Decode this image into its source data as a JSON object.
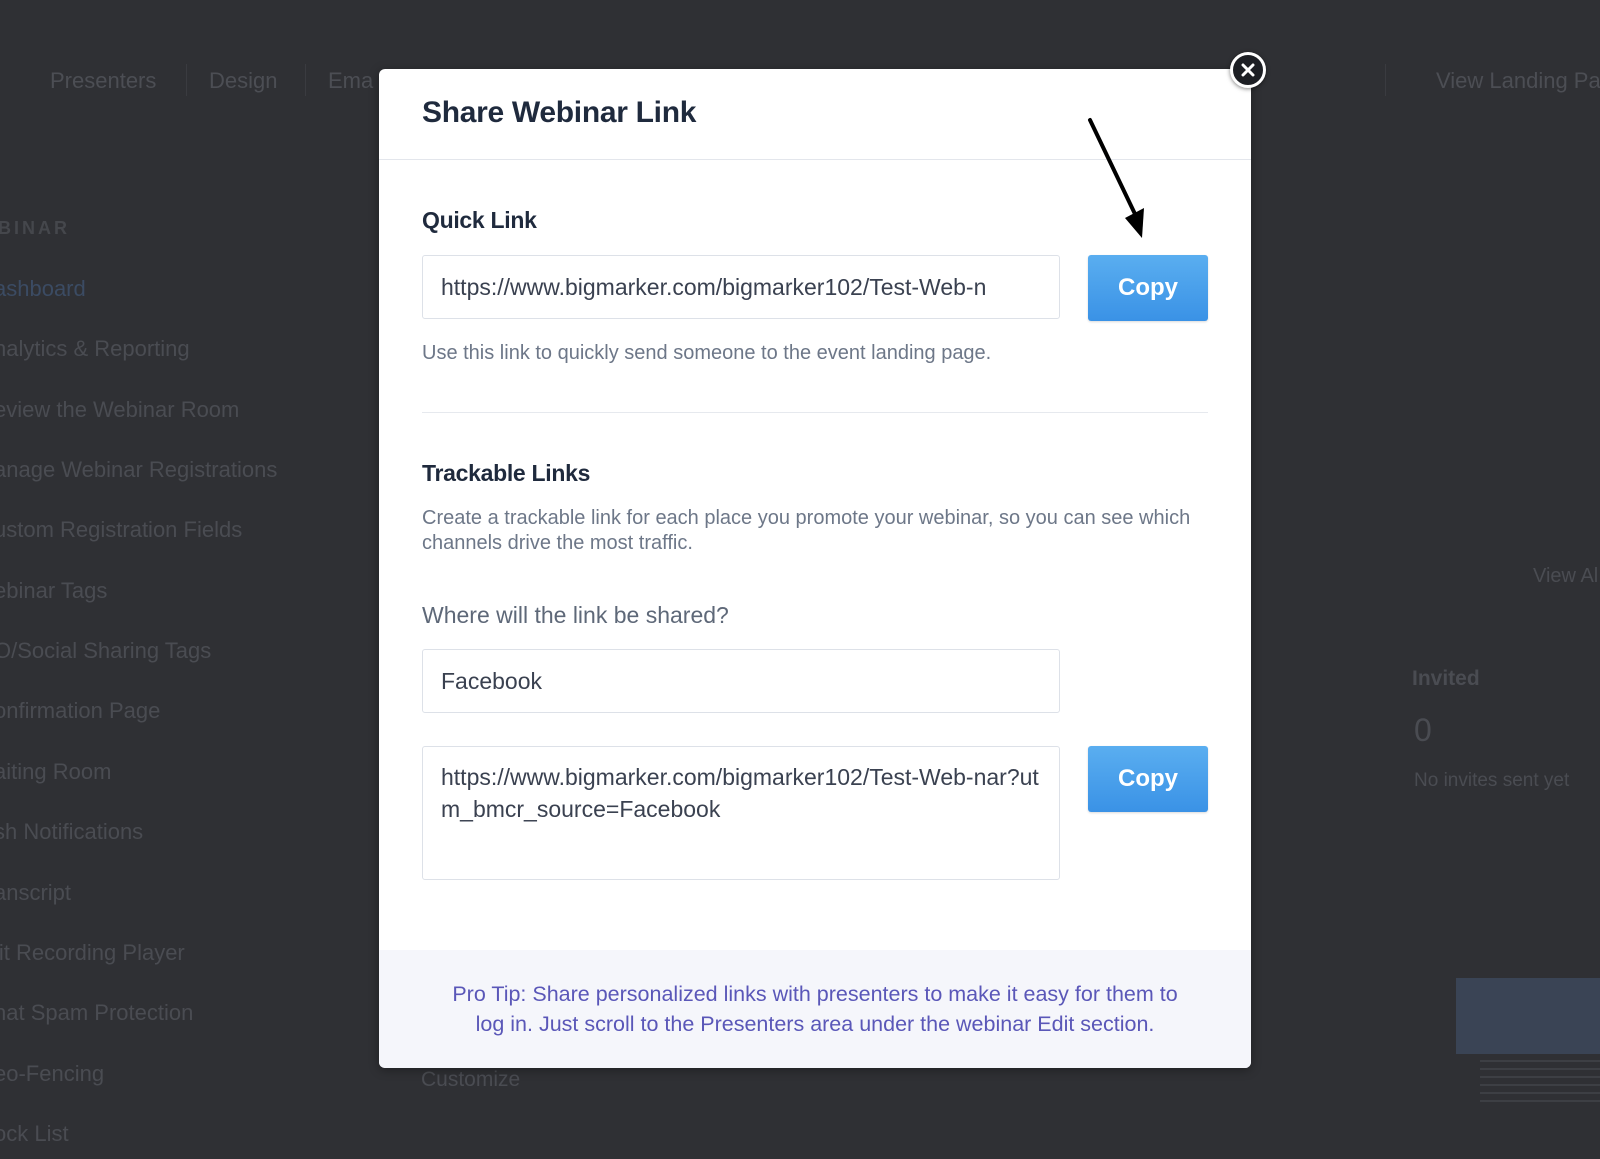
{
  "background": {
    "top_nav": [
      "Presenters",
      "Design",
      "Ema",
      "View Landing Pa"
    ],
    "sidebar_section": "BINAR",
    "sidebar_items": [
      "ashboard",
      "nalytics & Reporting",
      "eview the Webinar Room",
      "anage Webinar Registrations",
      "ustom Registration Fields",
      "ebinar Tags",
      "O/Social Sharing Tags",
      "onfirmation Page",
      "aiting Room",
      "sh Notifications",
      "anscript",
      "lit Recording Player",
      "hat Spam Protection",
      "eo-Fencing",
      "ock List"
    ],
    "view_all": "View Al",
    "invited_label": "Invited",
    "invited_count": "0",
    "invited_note": "No invites sent yet",
    "customize_link": "Customize"
  },
  "modal": {
    "title": "Share Webinar Link",
    "quick_link": {
      "label": "Quick Link",
      "url": "https://www.bigmarker.com/bigmarker102/Test-Web-n",
      "copy_label": "Copy",
      "helper": "Use this link to quickly send someone to the event landing page."
    },
    "trackable": {
      "label": "Trackable Links",
      "description": "Create a trackable link for each place you promote your webinar, so you can see which channels drive the most traffic.",
      "question": "Where will the link be shared?",
      "channel_value": "Facebook",
      "generated_url": "https://www.bigmarker.com/bigmarker102/Test-Web-nar?utm_bmcr_source=Facebook",
      "copy_label": "Copy"
    },
    "pro_tip": "Pro Tip: Share personalized links with presenters to make it easy for them to log in. Just scroll to the Presenters area under the webinar Edit section."
  },
  "icons": {
    "close": "close-icon",
    "annotation": "arrow-down-icon"
  },
  "colors": {
    "overlay": "#2f3034",
    "copy_button": "#4a9fec",
    "pro_tip_text": "#5a57b8",
    "title_text": "#1f2a3d"
  }
}
